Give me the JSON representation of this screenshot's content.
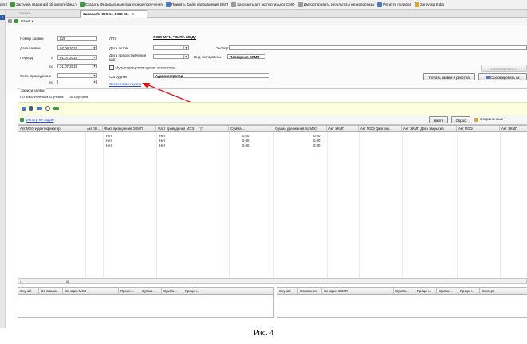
{
  "toolbar": {
    "items": [
      {
        "label": "рег.)",
        "icon": "none"
      },
      {
        "label": "Загрузка сведений об оплате(фед.)",
        "icon": "green-download-icon"
      },
      {
        "label": "Создать Федеральные платежные поручения",
        "icon": "green-create-icon"
      },
      {
        "label": "Принять файл направлений ВМП",
        "icon": "import-icon"
      },
      {
        "label": "Загрузить акт экспертизы от СМО",
        "icon": "upload-icon"
      },
      {
        "label": "Импортировать результаты реэкспертизы",
        "icon": "import-icon"
      },
      {
        "label": "Регистр полисов",
        "icon": "registry-icon"
      },
      {
        "label": "Загрузка К фа",
        "icon": "download-icon"
      }
    ]
  },
  "left_strip": {
    "tab_label": "≡"
  },
  "tabs": [
    {
      "label": "Заявки"
    },
    {
      "label": "Заявка № 829 по ООО М..",
      "close": "×"
    }
  ],
  "subtoolbar": {
    "report_label": "Отчет ▾"
  },
  "form": {
    "request_number_label": "Номер заявки",
    "request_number": "829",
    "request_date_label": "Дата заявки",
    "request_date": "07.08.2019",
    "period_label": "Период",
    "period_from_label": "с",
    "period_from": "01.07.2019",
    "period_to_label": "по",
    "period_to": "31.07.2019",
    "exam_label": "Эксп. проведена с",
    "exam_to_label": "по",
    "lpu_label": "ЛПУ",
    "lpu_value": "ООО МРЦ \"ВИТА МЕД\"",
    "acts_date_label": "Дата актов",
    "expert_label": "Эксперт",
    "cards_date_label": "Дата предоставления карт",
    "exam_type_label": "Вид экспертизы",
    "exam_type_value": "Повторная ЭКМП",
    "multidisc_label": "Мультидисциплинарная экспертиза",
    "employee_label": "Сотрудник",
    "employee_value": "Администратор",
    "expert_group_link": "Экспертная группа",
    "btn_print": "Печать заявки и реестра",
    "btn_form_act": "Сформировать ак",
    "btn_form_act_disabled": "Сформировать а"
  },
  "records": {
    "title": "Записи заявки",
    "tab_finished": "По законченным случаям",
    "tab_cases": "По случаям"
  },
  "filterbar": {
    "filter_link": "Фильтр не задан",
    "find_button": "Найти",
    "reset_button": "Сброс",
    "saved_button": "Сохраненные ▾"
  },
  "grid": {
    "columns": [
      "Акт МЭЭ Идентификатор",
      "Акт ЭК..",
      "Факт проведения ЭКМП",
      "Факт проведения МЭЭ",
      "Сумма ...",
      "Сумма удержаний по МЭЭ",
      "Акт ЭКМП",
      "Акт МЭЭ Дата зак..",
      "Акт ЭКМП Дата закрытия",
      "Акт МЭЭ",
      "Акт ЭКМП"
    ],
    "rows": [
      {
        "ekmp": "Нет",
        "mee": "Нет",
        "sum": "0,00",
        "held": "0,00"
      },
      {
        "ekmp": "Нет",
        "mee": "Нет",
        "sum": "0,00",
        "held": "0,00"
      },
      {
        "ekmp": "Нет",
        "mee": "Нет",
        "sum": "0,00",
        "held": "0,00"
      }
    ],
    "scroll_marker": "|||"
  },
  "subgrid_left": {
    "columns": [
      "Случай",
      "Основание",
      "Санкция МЭЭ",
      "Процен..",
      "Сумма ..",
      "Сумма ..",
      "Процен.."
    ]
  },
  "subgrid_right": {
    "columns": [
      "Случай",
      "Основание",
      "Санкция ЭКМП",
      "Сумма ..",
      "Процен..",
      "Сумма ..",
      "Процен..",
      "Эксперт"
    ]
  },
  "caption": "Рис. 4",
  "colors": {
    "link": "#2c4fd0",
    "arrow": "#e01010",
    "filter_bg": "#fdfde0"
  }
}
